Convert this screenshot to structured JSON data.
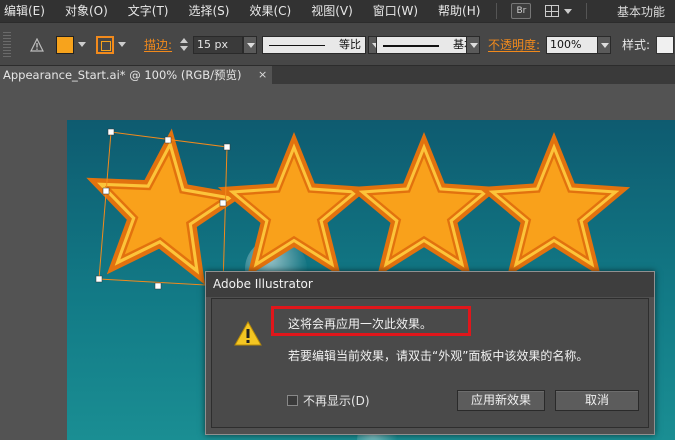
{
  "menu": {
    "items": [
      "编辑(E)",
      "对象(O)",
      "文字(T)",
      "选择(S)",
      "效果(C)",
      "视图(V)",
      "窗口(W)",
      "帮助(H)"
    ],
    "bridge_label": "Br",
    "workspace": "基本功能"
  },
  "controls": {
    "fill_color": "#f7a31c",
    "stroke_color": "#f28a1c",
    "stroke_label": "描边:",
    "stroke_weight": "15 px",
    "profile1": "等比",
    "profile2": "基本",
    "opacity_label": "不透明度:",
    "opacity_value": "100%",
    "style_label": "样式:"
  },
  "document": {
    "tab_title": "Appearance_Start.ai* @ 100% (RGB/预览)",
    "close_glyph": "×"
  },
  "dialog": {
    "title": "Adobe Illustrator",
    "message": "这将会再应用一次此效果。",
    "detail": "若要编辑当前效果，请双击“外观”面板中该效果的名称。",
    "dont_show_label": "不再显示(D)",
    "apply_button": "应用新效果",
    "cancel_button": "取消"
  },
  "colors": {
    "star_outer": "#e2720e",
    "star_band": "#fcc43a",
    "star_inner": "#f9a11b",
    "artboard": "#127a86",
    "highlight": "#e0161b"
  }
}
